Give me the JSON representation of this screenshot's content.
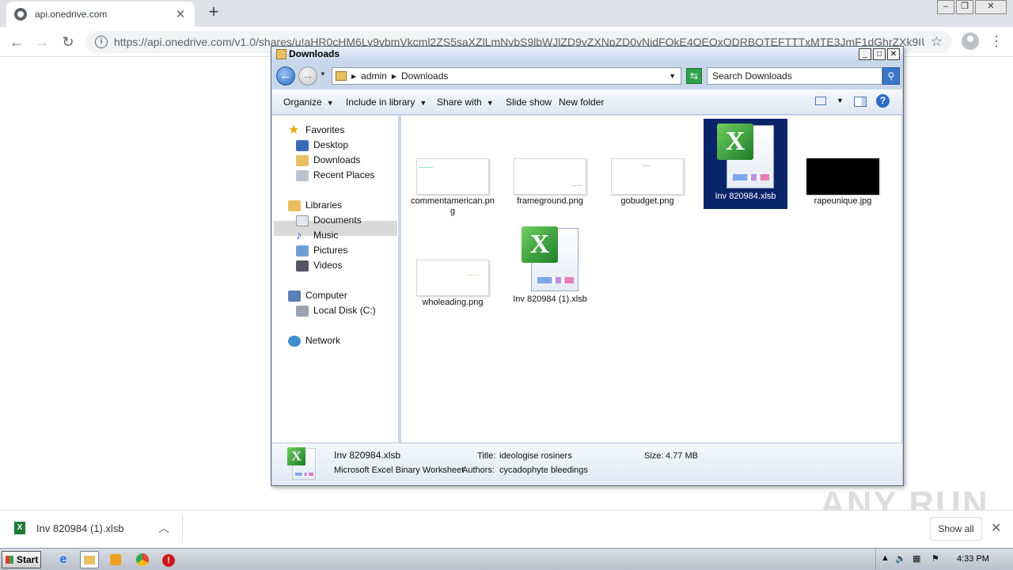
{
  "browser": {
    "tab_title": "api.onedrive.com",
    "url": "https://api.onedrive.com/v1.0/shares/u!aHR0cHM6Ly9vbmVkcml2ZS5saXZlLmNvbS9lbWJlZD9yZXNpZD0yNjdFQkE4QEQxODRBOTEFTTTxMTE3JmF1dGhrZXk9IUFK..."
  },
  "explorer": {
    "window_title": "Downloads",
    "breadcrumb": [
      "admin",
      "Downloads"
    ],
    "search_placeholder": "Search Downloads",
    "commands": {
      "organize": "Organize",
      "include": "Include in library",
      "share": "Share with",
      "slideshow": "Slide show",
      "newfolder": "New folder"
    },
    "nav": {
      "favorites": "Favorites",
      "desktop": "Desktop",
      "downloads": "Downloads",
      "recent": "Recent Places",
      "libraries": "Libraries",
      "documents": "Documents",
      "music": "Music",
      "pictures": "Pictures",
      "videos": "Videos",
      "computer": "Computer",
      "localdisk": "Local Disk (C:)",
      "network": "Network"
    },
    "files": [
      {
        "name": "commentamerican.png"
      },
      {
        "name": "frameground.png"
      },
      {
        "name": "gobudget.png"
      },
      {
        "name": "Inv 820984.xlsb"
      },
      {
        "name": "rapeunique.jpg"
      },
      {
        "name": "wholeading.png"
      },
      {
        "name": "Inv 820984 (1).xlsb"
      }
    ],
    "details": {
      "name": "Inv 820984.xlsb",
      "type": "Microsoft Excel Binary Worksheet",
      "title_label": "Title:",
      "title_value": "ideologise rosiners",
      "authors_label": "Authors:",
      "authors_value": "cycadophyte bleedings",
      "size_label": "Size:",
      "size_value": "4.77 MB"
    }
  },
  "downloads_bar": {
    "item": "Inv 820984 (1).xlsb",
    "show_all": "Show all"
  },
  "watermark": "ANY RUN",
  "taskbar": {
    "start": "Start",
    "clock": "4:33 PM"
  }
}
